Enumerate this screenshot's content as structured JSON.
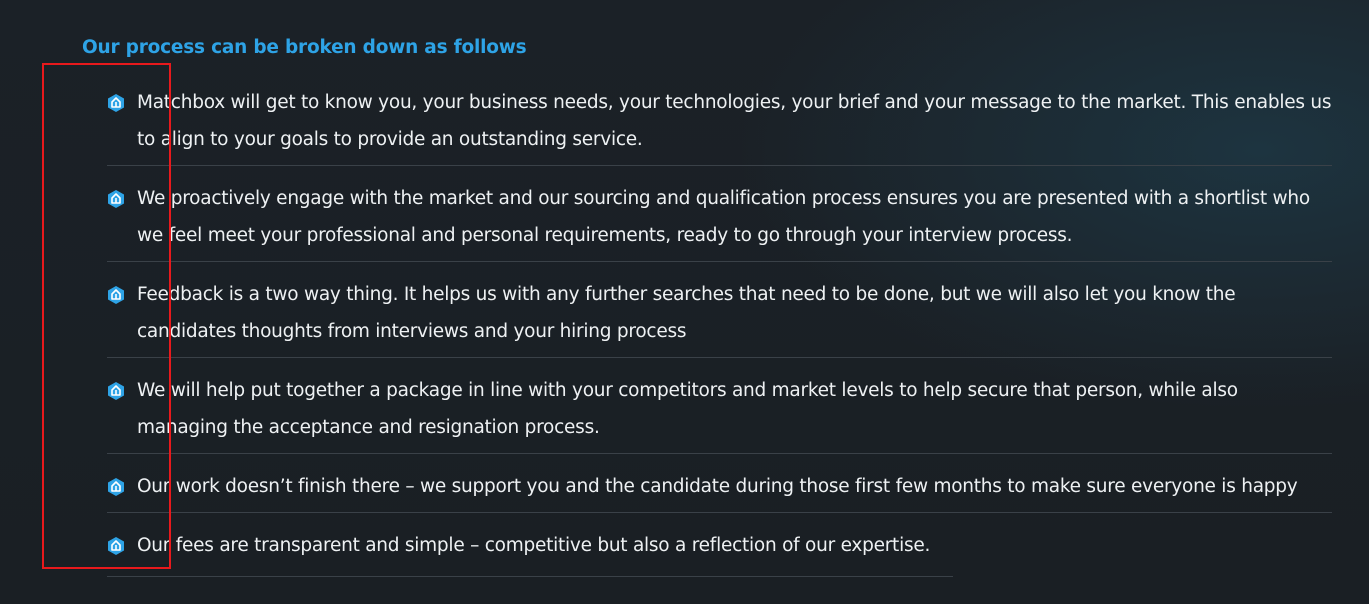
{
  "heading": "Our process can be broken down as follows",
  "bullet_icon": "hexagon-arrow-icon",
  "accent_color": "#2ea3e6",
  "highlight_color": "#e8191c",
  "items": [
    {
      "text": "Matchbox will get to know you, your business needs, your technologies, your brief and your message to the market. This enables us to align to your goals to provide an outstanding service."
    },
    {
      "text": "We proactively engage with the market and our sourcing and qualification process ensures you are presented with a shortlist who we feel meet your professional and personal requirements, ready to go through your interview process."
    },
    {
      "text": "Feedback is a two way thing. It helps us with any further searches that need to be done, but we will also let you know the candidates thoughts from interviews and your hiring process"
    },
    {
      "text": "We will help put together a package in line with your competitors and market levels to help secure that person, while also managing the acceptance and resignation process."
    },
    {
      "text": "Our work doesn’t finish there – we support you and the candidate during those first few months to make sure everyone is happy"
    },
    {
      "text": "Our fees are transparent and simple – competitive but also a reflection of our expertise."
    }
  ]
}
